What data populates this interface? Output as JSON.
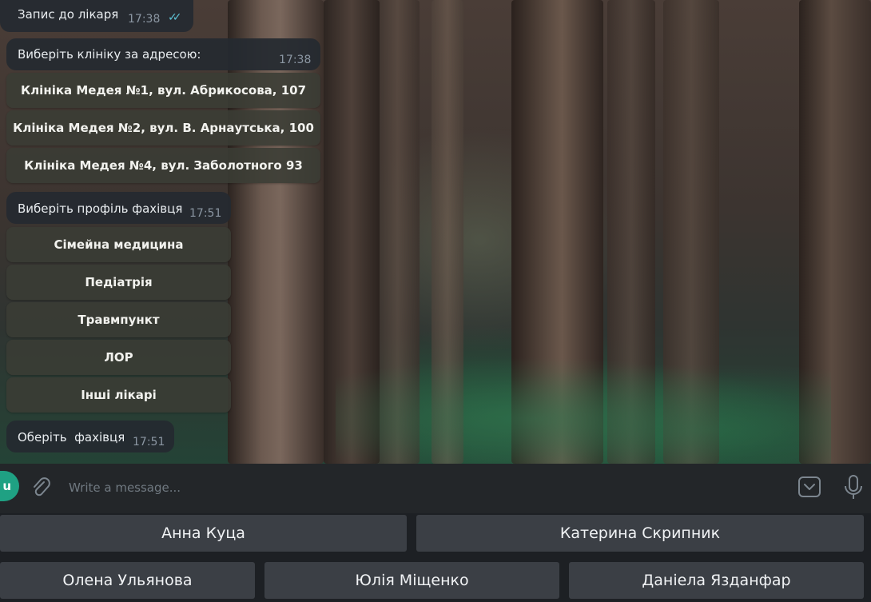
{
  "messages": {
    "m1": {
      "text": "Запис до лікаря",
      "time": "17:38",
      "status": "read"
    },
    "m2": {
      "text": "Виберіть клініку за адресою:",
      "time": "17:38"
    },
    "clinics": [
      "Клініка Медея №1, вул. Абрикосова, 107",
      "Клініка Медея №2, вул. В. Арнаутська, 100",
      "Клініка Медея №4, вул. Заболотного 93"
    ],
    "m3": {
      "text": "Виберіть профіль фахівця",
      "time": "17:51"
    },
    "profiles": [
      "Сімейна медицина",
      "Педіатрія",
      "Травмпункт",
      "ЛОР",
      "Інші лікарі"
    ],
    "m4": {
      "text": "Оберіть  фахівця",
      "time": "17:51"
    }
  },
  "composer": {
    "avatar_letter": "u",
    "placeholder": "Write a message...",
    "icons": [
      "attach-icon",
      "keyboard-icon",
      "microphone-icon"
    ]
  },
  "reply_keyboard": {
    "row1": [
      "Анна Куца",
      "Катерина Скрипник"
    ],
    "row2": [
      "Олена Ульянова",
      "Юлія Міщенко",
      "Даніела Язданфар"
    ]
  },
  "colors": {
    "accent": "#1fa183",
    "read_check": "#5ec3d6",
    "bubble": "#252a30",
    "inline_button": "#3a3c34"
  }
}
